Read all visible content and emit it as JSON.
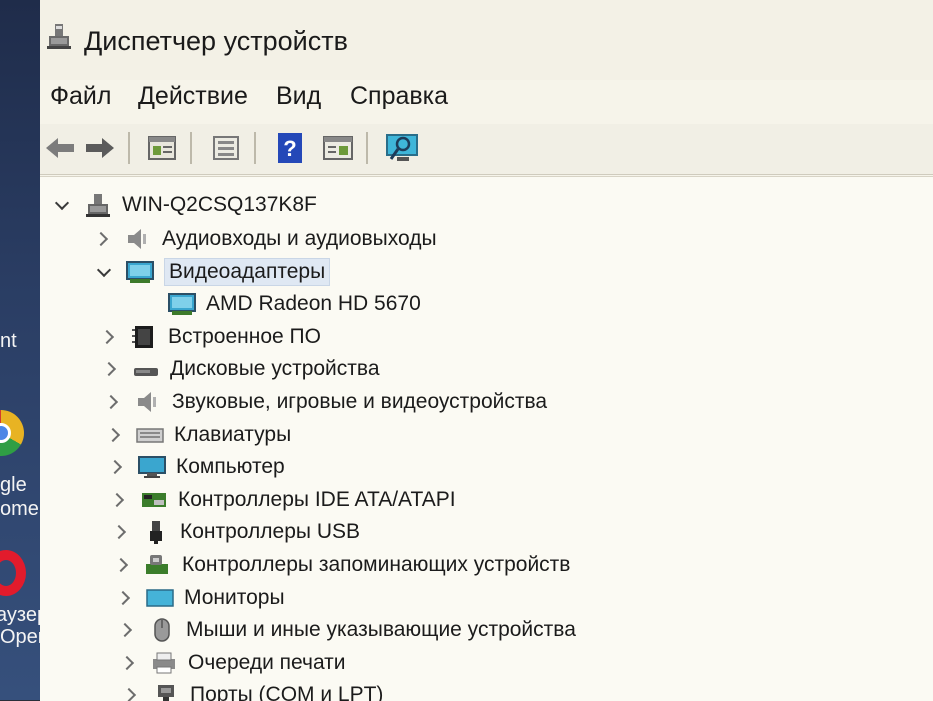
{
  "desktop": {
    "fragments": [
      "nt",
      "gle",
      "ome",
      "аузер",
      "Opera"
    ]
  },
  "window": {
    "title": "Диспетчер устройств",
    "menu": [
      "Файл",
      "Действие",
      "Вид",
      "Справка"
    ],
    "toolbar": [
      "back-arrow-icon",
      "forward-arrow-icon",
      "properties-icon",
      "update-driver-icon",
      "help-icon",
      "show-hidden-icon",
      "scan-hardware-icon"
    ]
  },
  "tree": {
    "root": "WIN-Q2CSQ137K8F",
    "items": [
      {
        "label": "Аудиовходы и аудиовыходы",
        "icon": "speaker-icon",
        "state": "collapsed"
      },
      {
        "label": "Видеоадаптеры",
        "icon": "display-adapter-icon",
        "state": "expanded",
        "selected": true
      },
      {
        "label": "AMD Radeon HD 5670",
        "icon": "display-adapter-icon",
        "state": "leaf",
        "child": true
      },
      {
        "label": "Встроенное ПО",
        "icon": "firmware-icon",
        "state": "collapsed"
      },
      {
        "label": "Дисковые устройства",
        "icon": "disk-drive-icon",
        "state": "collapsed"
      },
      {
        "label": "Звуковые, игровые и видеоустройства",
        "icon": "speaker-icon",
        "state": "collapsed"
      },
      {
        "label": "Клавиатуры",
        "icon": "keyboard-icon",
        "state": "collapsed"
      },
      {
        "label": "Компьютер",
        "icon": "computer-icon",
        "state": "collapsed"
      },
      {
        "label": "Контроллеры IDE ATA/ATAPI",
        "icon": "ide-controller-icon",
        "state": "collapsed"
      },
      {
        "label": "Контроллеры USB",
        "icon": "usb-icon",
        "state": "collapsed"
      },
      {
        "label": "Контроллеры запоминающих устройств",
        "icon": "storage-controller-icon",
        "state": "collapsed"
      },
      {
        "label": "Мониторы",
        "icon": "monitor-icon",
        "state": "collapsed"
      },
      {
        "label": "Мыши и иные указывающие устройства",
        "icon": "mouse-icon",
        "state": "collapsed"
      },
      {
        "label": "Очереди печати",
        "icon": "printer-icon",
        "state": "collapsed"
      },
      {
        "label": "Порты (COM и LPT)",
        "icon": "port-icon",
        "state": "collapsed"
      }
    ]
  }
}
